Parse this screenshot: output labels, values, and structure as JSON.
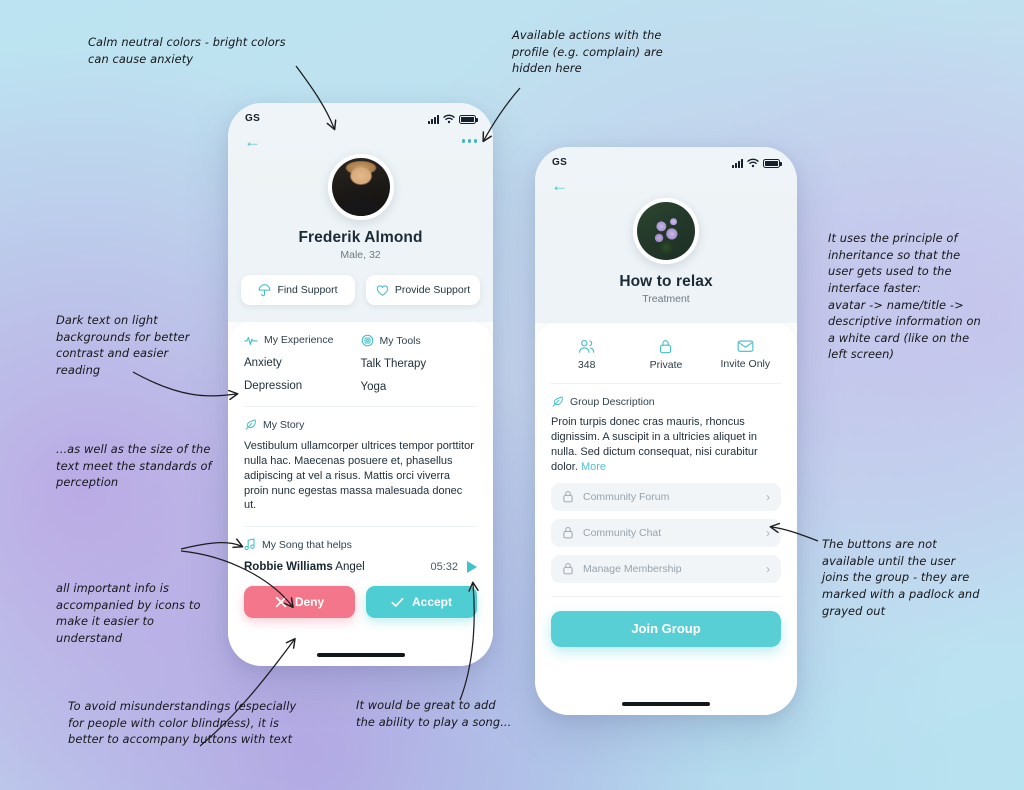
{
  "background": {
    "colors": [
      "#bce3f1",
      "#c6dff0",
      "#baa8e4",
      "#b7e2f0"
    ]
  },
  "theme": {
    "accent": "#4ecdd2",
    "danger": "#f4768a",
    "text_dark": "#1d2b36",
    "muted": "#97a3ad"
  },
  "left_phone": {
    "statusbar": {
      "carrier": "GS",
      "signal_icon": "signal-bars-icon",
      "wifi_icon": "wifi-icon",
      "battery_icon": "battery-icon"
    },
    "nav": {
      "back_icon": "back-arrow-icon",
      "more_icon": "more-options-icon"
    },
    "avatar_icon": "profile-avatar-photo",
    "name": "Frederik Almond",
    "subtitle": "Male, 32",
    "actions": [
      {
        "label": "Find Support",
        "icon": "umbrella-icon"
      },
      {
        "label": "Provide Support",
        "icon": "heart-icon"
      }
    ],
    "experience": {
      "heading": "My Experience",
      "icon": "pulse-icon",
      "items": [
        "Anxiety",
        "Depression"
      ]
    },
    "tools": {
      "heading": "My Tools",
      "icon": "tools-badge-icon",
      "items": [
        "Talk Therapy",
        "Yoga"
      ]
    },
    "story": {
      "heading": "My Story",
      "icon": "feather-icon",
      "text": "Vestibulum ullamcorper ultrices tempor porttitor nulla hac. Maecenas posuere et, phasellus adipiscing at vel a risus. Mattis orci viverra proin nunc egestas massa malesuada donec ut."
    },
    "song": {
      "heading": "My Song that helps",
      "icon": "music-note-icon",
      "artist": "Robbie Williams",
      "title": "Angel",
      "duration": "05:32",
      "play_icon": "play-icon"
    },
    "buttons": [
      {
        "label": "Deny",
        "icon": "close-x-icon",
        "color": "#f4768a"
      },
      {
        "label": "Accept",
        "icon": "check-icon",
        "color": "#4ecdd2"
      }
    ]
  },
  "right_phone": {
    "statusbar": {
      "carrier": "GS",
      "signal_icon": "signal-bars-icon",
      "wifi_icon": "wifi-icon",
      "battery_icon": "battery-icon"
    },
    "nav": {
      "back_icon": "back-arrow-icon"
    },
    "avatar_icon": "group-avatar-photo",
    "title": "How to relax",
    "subtitle": "Treatment",
    "stats": [
      {
        "value": "348",
        "icon": "members-icon"
      },
      {
        "value": "Private",
        "icon": "lock-icon"
      },
      {
        "value": "Invite Only",
        "icon": "envelope-icon"
      }
    ],
    "description": {
      "heading": "Group Description",
      "icon": "feather-icon",
      "text": "Proin turpis donec cras mauris, rhoncus dignissim. A suscipit in a ultricies aliquet in nulla. Sed dictum consequat, nisi curabitur dolor.",
      "more_label": "More"
    },
    "locked_items": [
      {
        "label": "Community Forum",
        "icon": "padlock-icon",
        "chevron": "chevron-right-icon"
      },
      {
        "label": "Community Chat",
        "icon": "padlock-icon",
        "chevron": "chevron-right-icon"
      },
      {
        "label": "Manage Membership",
        "icon": "padlock-icon",
        "chevron": "chevron-right-icon"
      }
    ],
    "join_button": "Join Group"
  },
  "annotations": [
    {
      "id": "a1",
      "text": "Calm neutral colors - bright colors\ncan cause anxiety"
    },
    {
      "id": "a2",
      "text": "Available actions with the\nprofile (e.g. complain) are\nhidden here"
    },
    {
      "id": "a3",
      "text": "Dark text on light\nbackgrounds for better\ncontrast and easier\nreading"
    },
    {
      "id": "a4",
      "text": "...as well as the size of the\ntext meet the standards of\nperception"
    },
    {
      "id": "a5",
      "text": "all important info is\naccompanied by icons to\nmake it easier to\nunderstand"
    },
    {
      "id": "a6",
      "text": "To avoid misunderstandings (especially\nfor people with color blindness), it is\nbetter to accompany buttons with text"
    },
    {
      "id": "a7",
      "text": "It would be great to add\nthe ability to play a song..."
    },
    {
      "id": "a8",
      "text": "It uses the principle of\ninheritance so that the\nuser gets used to the\ninterface faster:\navatar -> name/title ->\ndescriptive information on\na white card (like on the\nleft screen)"
    },
    {
      "id": "a9",
      "text": "The buttons are not\navailable until the user\njoins the group - they are\nmarked with a padlock and\ngrayed out"
    }
  ]
}
